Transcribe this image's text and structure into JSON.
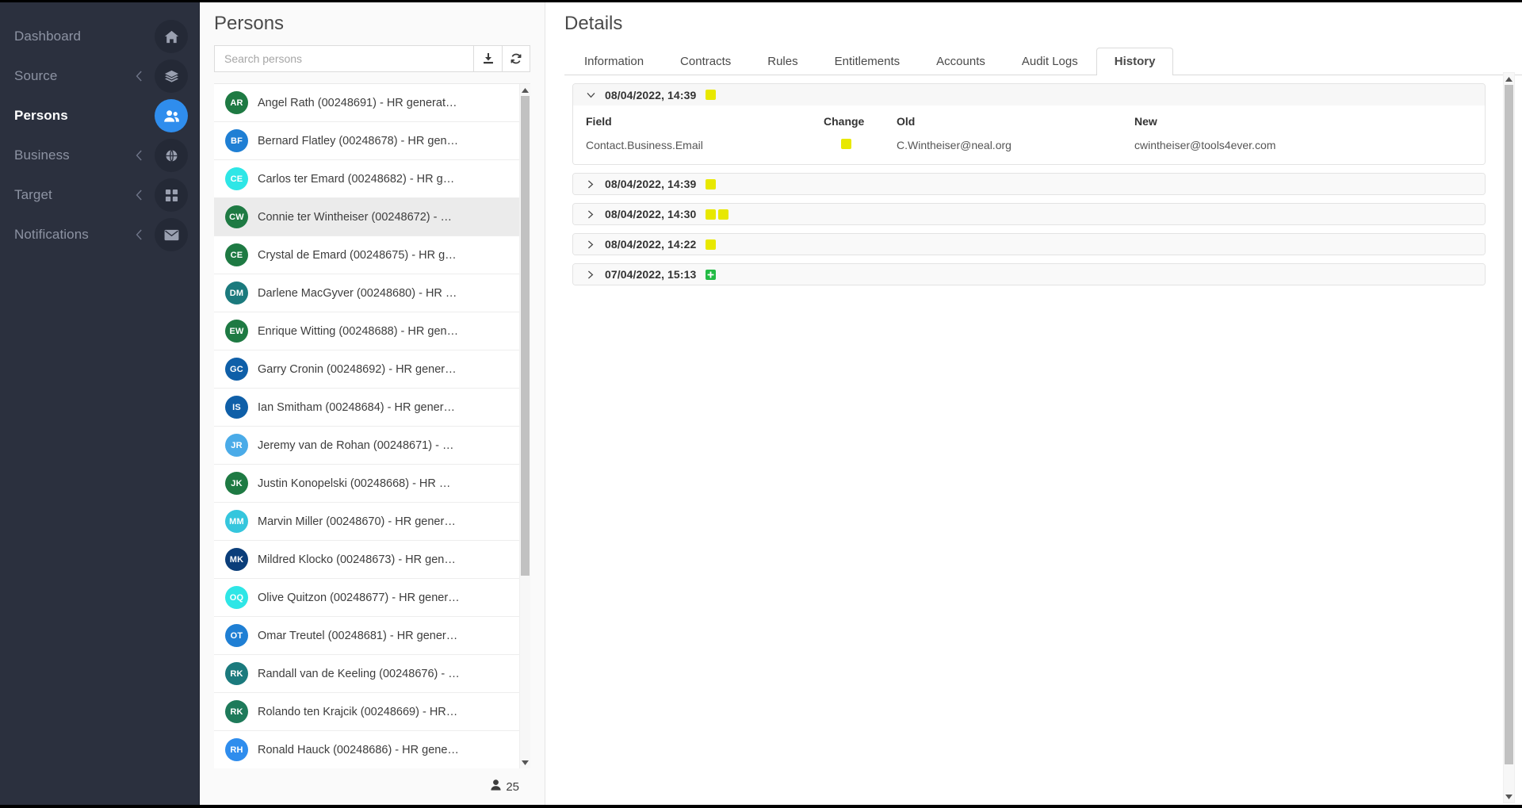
{
  "sidebar": {
    "items": [
      {
        "label": "Dashboard",
        "icon": "home-icon",
        "chevron": false,
        "active": false
      },
      {
        "label": "Source",
        "icon": "layers-icon",
        "chevron": true,
        "active": false
      },
      {
        "label": "Persons",
        "icon": "people-icon",
        "chevron": false,
        "active": true
      },
      {
        "label": "Business",
        "icon": "globe-icon",
        "chevron": true,
        "active": false
      },
      {
        "label": "Target",
        "icon": "grid-icon",
        "chevron": true,
        "active": false
      },
      {
        "label": "Notifications",
        "icon": "envelope-icon",
        "chevron": true,
        "active": false
      }
    ],
    "active_color": "#2f8ded",
    "background": "#2b303e"
  },
  "persons_panel": {
    "title": "Persons",
    "search": {
      "value": "",
      "placeholder": "Search persons"
    },
    "buttons": [
      {
        "name": "download-button",
        "icon": "download-icon"
      },
      {
        "name": "refresh-button",
        "icon": "refresh-icon"
      }
    ],
    "items": [
      {
        "initials": "AR",
        "color": "#1e7a43",
        "label": "Angel Rath (00248691) - HR generat…",
        "selected": false
      },
      {
        "initials": "BF",
        "color": "#1f7fd4",
        "label": "Bernard Flatley (00248678) - HR gen…",
        "selected": false
      },
      {
        "initials": "CE",
        "color": "#2ee6e6",
        "label": "Carlos ter Emard (00248682) - HR g…",
        "selected": false
      },
      {
        "initials": "CW",
        "color": "#1e7a43",
        "label": "Connie ter Wintheiser (00248672) - …",
        "selected": true
      },
      {
        "initials": "CE",
        "color": "#1e7a43",
        "label": "Crystal de Emard (00248675) - HR g…",
        "selected": false
      },
      {
        "initials": "DM",
        "color": "#1b7a7d",
        "label": "Darlene MacGyver (00248680) - HR …",
        "selected": false
      },
      {
        "initials": "EW",
        "color": "#1e7a43",
        "label": "Enrique Witting (00248688) - HR gen…",
        "selected": false
      },
      {
        "initials": "GC",
        "color": "#0f5fa8",
        "label": "Garry Cronin (00248692) - HR gener…",
        "selected": false
      },
      {
        "initials": "IS",
        "color": "#0f5fa8",
        "label": "Ian Smitham (00248684) - HR gener…",
        "selected": false
      },
      {
        "initials": "JR",
        "color": "#4aabe8",
        "label": "Jeremy van de Rohan (00248671) - …",
        "selected": false
      },
      {
        "initials": "JK",
        "color": "#1e7a43",
        "label": "Justin Konopelski (00248668) - HR …",
        "selected": false
      },
      {
        "initials": "MM",
        "color": "#35c6dd",
        "label": "Marvin Miller (00248670) - HR gener…",
        "selected": false
      },
      {
        "initials": "MK",
        "color": "#0b3e7a",
        "label": "Mildred Klocko (00248673) - HR gen…",
        "selected": false
      },
      {
        "initials": "OQ",
        "color": "#2ee6e6",
        "label": "Olive Quitzon (00248677) - HR gener…",
        "selected": false
      },
      {
        "initials": "OT",
        "color": "#1f7fd4",
        "label": "Omar Treutel (00248681) - HR gener…",
        "selected": false
      },
      {
        "initials": "RK",
        "color": "#1b7a7d",
        "label": "Randall van de Keeling (00248676) - …",
        "selected": false
      },
      {
        "initials": "RK",
        "color": "#1e7a5a",
        "label": "Rolando ten Krajcik (00248669) - HR…",
        "selected": false
      },
      {
        "initials": "RH",
        "color": "#2f8ded",
        "label": "Ronald Hauck (00248686) - HR gene…",
        "selected": false
      }
    ],
    "footer": {
      "icon": "person-icon",
      "count": "25"
    }
  },
  "details_panel": {
    "title": "Details",
    "tabs": [
      {
        "label": "Information",
        "active": false
      },
      {
        "label": "Contracts",
        "active": false
      },
      {
        "label": "Rules",
        "active": false
      },
      {
        "label": "Entitlements",
        "active": false
      },
      {
        "label": "Accounts",
        "active": false
      },
      {
        "label": "Audit Logs",
        "active": false
      },
      {
        "label": "History",
        "active": true
      }
    ],
    "history": {
      "columns": [
        "Field",
        "Change",
        "Old",
        "New"
      ],
      "entries": [
        {
          "date": "08/04/2022, 14:39",
          "expanded": true,
          "badges": [
            {
              "type": "update",
              "color": "#e8e800"
            }
          ],
          "rows": [
            {
              "field": "Contact.Business.Email",
              "change": {
                "type": "update",
                "color": "#e8e800"
              },
              "old": "C.Wintheiser@neal.org",
              "new": "cwintheiser@tools4ever.com"
            }
          ]
        },
        {
          "date": "08/04/2022, 14:39",
          "expanded": false,
          "badges": [
            {
              "type": "update",
              "color": "#e8e800"
            }
          ],
          "rows": []
        },
        {
          "date": "08/04/2022, 14:30",
          "expanded": false,
          "badges": [
            {
              "type": "update",
              "color": "#e8e800"
            },
            {
              "type": "update",
              "color": "#e8e800"
            }
          ],
          "rows": []
        },
        {
          "date": "08/04/2022, 14:22",
          "expanded": false,
          "badges": [
            {
              "type": "update",
              "color": "#e8e800"
            }
          ],
          "rows": []
        },
        {
          "date": "07/04/2022, 15:13",
          "expanded": false,
          "badges": [
            {
              "type": "create",
              "color": "#22bb44"
            }
          ],
          "rows": []
        }
      ]
    }
  }
}
